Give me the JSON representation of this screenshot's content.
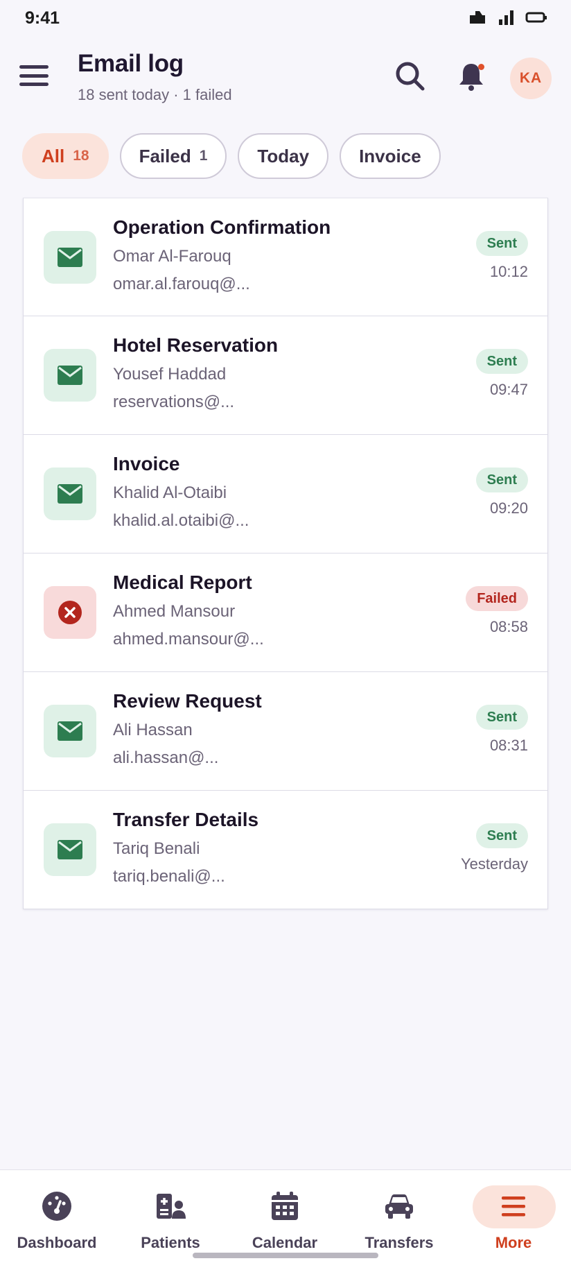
{
  "status": {
    "time": "9:41"
  },
  "header": {
    "title": "Email log",
    "subtitle": "18 sent today · 1 failed",
    "avatar_initials": "KA"
  },
  "filters": [
    {
      "label": "All",
      "count": "18",
      "active": true
    },
    {
      "label": "Failed",
      "count": "1",
      "active": false
    },
    {
      "label": "Today",
      "count": "",
      "active": false
    },
    {
      "label": "Invoice",
      "count": "",
      "active": false
    }
  ],
  "emails": [
    {
      "title": "Operation Confirmation",
      "name": "Omar Al-Farouq",
      "email": "omar.al.farouq@...",
      "status": "Sent",
      "time": "10:12"
    },
    {
      "title": "Hotel Reservation",
      "name": "Yousef Haddad",
      "email": "reservations@...",
      "status": "Sent",
      "time": "09:47"
    },
    {
      "title": "Invoice",
      "name": "Khalid Al-Otaibi",
      "email": "khalid.al.otaibi@...",
      "status": "Sent",
      "time": "09:20"
    },
    {
      "title": "Medical Report",
      "name": "Ahmed Mansour",
      "email": "ahmed.mansour@...",
      "status": "Failed",
      "time": "08:58"
    },
    {
      "title": "Review Request",
      "name": "Ali Hassan",
      "email": "ali.hassan@...",
      "status": "Sent",
      "time": "08:31"
    },
    {
      "title": "Transfer Details",
      "name": "Tariq Benali",
      "email": "tariq.benali@...",
      "status": "Sent",
      "time": "Yesterday"
    }
  ],
  "nav": [
    {
      "label": "Dashboard",
      "icon": "dashboard-icon"
    },
    {
      "label": "Patients",
      "icon": "patients-icon"
    },
    {
      "label": "Calendar",
      "icon": "calendar-icon"
    },
    {
      "label": "Transfers",
      "icon": "car-icon"
    },
    {
      "label": "More",
      "icon": "more-icon"
    }
  ],
  "colors": {
    "accent": "#cf3f1e",
    "sent": "#2d7d50",
    "failed": "#b3261e"
  }
}
